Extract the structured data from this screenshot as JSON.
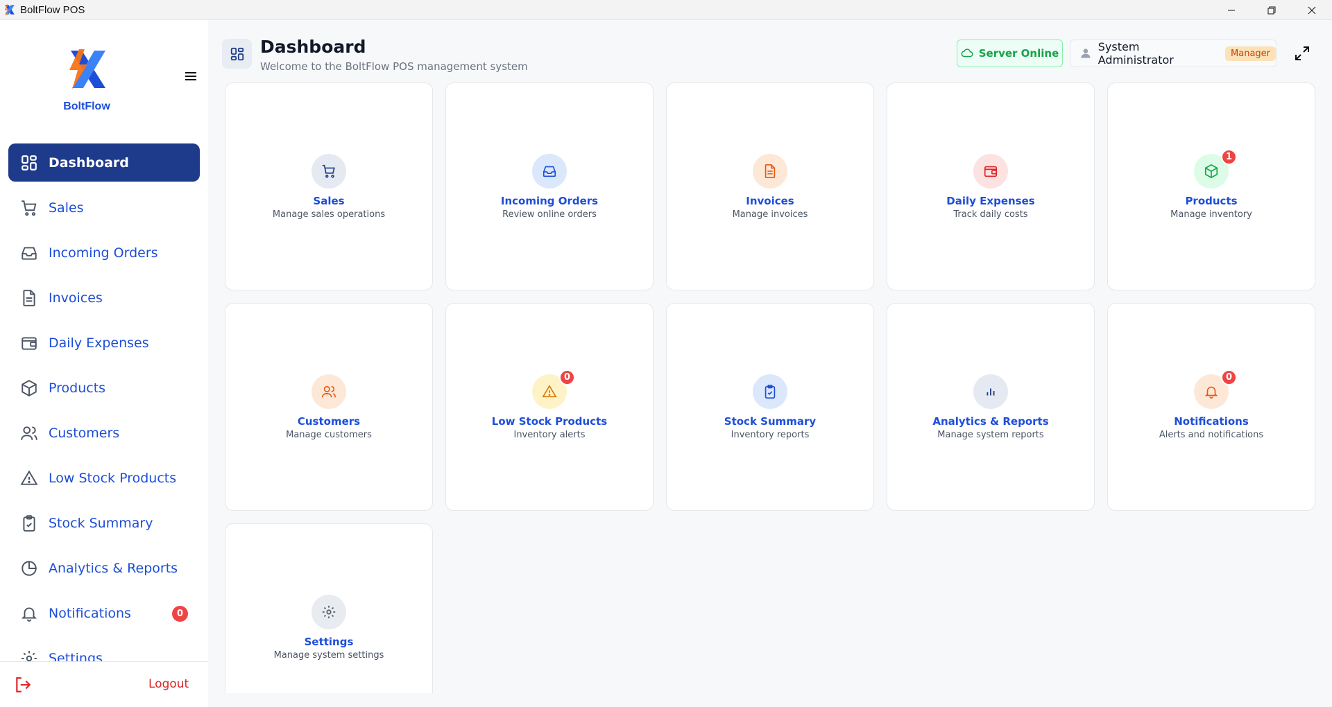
{
  "window": {
    "title": "BoltFlow POS"
  },
  "brand": {
    "name": "BoltFlow"
  },
  "sidebar": {
    "items": [
      {
        "label": "Dashboard",
        "icon": "dashboard-icon",
        "active": true
      },
      {
        "label": "Sales",
        "icon": "cart-icon"
      },
      {
        "label": "Incoming Orders",
        "icon": "inbox-icon"
      },
      {
        "label": "Invoices",
        "icon": "document-icon"
      },
      {
        "label": "Daily Expenses",
        "icon": "wallet-icon"
      },
      {
        "label": "Products",
        "icon": "box-icon"
      },
      {
        "label": "Customers",
        "icon": "users-icon"
      },
      {
        "label": "Low Stock Products",
        "icon": "warning-icon"
      },
      {
        "label": "Stock Summary",
        "icon": "clipboard-check-icon"
      },
      {
        "label": "Analytics & Reports",
        "icon": "pie-chart-icon"
      },
      {
        "label": "Notifications",
        "icon": "bell-icon",
        "badge": "0"
      },
      {
        "label": "Settings",
        "icon": "gear-icon"
      }
    ],
    "logout_label": "Logout"
  },
  "header": {
    "title": "Dashboard",
    "subtitle": "Welcome to the BoltFlow POS management system",
    "server_status": "Server Online",
    "user_name": "System Administrator",
    "user_role": "Manager"
  },
  "cards": [
    {
      "title": "Sales",
      "desc": "Manage sales operations",
      "icon": "cart-icon",
      "bg": "#e5e9f2",
      "fg": "#1e3a8a"
    },
    {
      "title": "Incoming Orders",
      "desc": "Review online orders",
      "icon": "inbox-icon",
      "bg": "#dbe7fb",
      "fg": "#1d4ed8"
    },
    {
      "title": "Invoices",
      "desc": "Manage invoices",
      "icon": "document-icon",
      "bg": "#fde8d8",
      "fg": "#ea580c"
    },
    {
      "title": "Daily Expenses",
      "desc": "Track daily costs",
      "icon": "wallet-icon",
      "bg": "#fde2e2",
      "fg": "#dc2626"
    },
    {
      "title": "Products",
      "desc": "Manage inventory",
      "icon": "box-icon",
      "bg": "#dcfce7",
      "fg": "#16a34a",
      "badge": "1"
    },
    {
      "title": "Customers",
      "desc": "Manage customers",
      "icon": "users-icon",
      "bg": "#fde8d8",
      "fg": "#ea580c"
    },
    {
      "title": "Low Stock Products",
      "desc": "Inventory alerts",
      "icon": "warning-icon",
      "bg": "#fef3c7",
      "fg": "#d97706",
      "badge": "0"
    },
    {
      "title": "Stock Summary",
      "desc": "Inventory reports",
      "icon": "clipboard-check-icon",
      "bg": "#dbe7fb",
      "fg": "#1d4ed8"
    },
    {
      "title": "Analytics & Reports",
      "desc": "Manage system reports",
      "icon": "bar-chart-icon",
      "bg": "#e5e9f2",
      "fg": "#1e3a8a"
    },
    {
      "title": "Notifications",
      "desc": "Alerts and notifications",
      "icon": "bell-icon",
      "bg": "#fde8d8",
      "fg": "#ea580c",
      "badge": "0"
    },
    {
      "title": "Settings",
      "desc": "Manage system settings",
      "icon": "gear-icon",
      "bg": "#e8ebef",
      "fg": "#4b5563"
    }
  ],
  "colors": {
    "accent": "#1d4ed8",
    "active_nav": "#1e3a8a",
    "badge": "#ef4444",
    "online": "#16a34a"
  }
}
